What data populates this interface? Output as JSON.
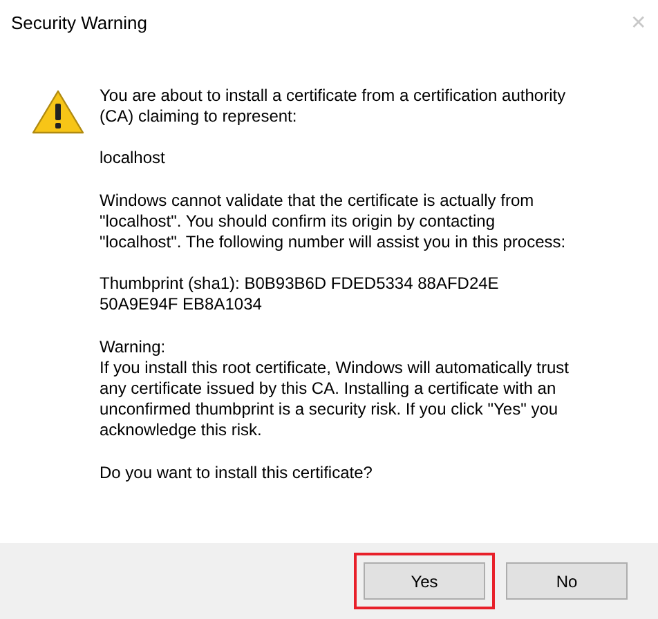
{
  "window": {
    "title": "Security Warning",
    "close": "✕"
  },
  "message": {
    "paragraphs": [
      "You are about to install a certificate from a certification authority (CA) claiming to represent:",
      "localhost",
      "Windows cannot validate that the certificate is actually from \"localhost\". You should confirm its origin by contacting \"localhost\". The following number will assist you in this process:",
      "Thumbprint (sha1): B0B93B6D FDED5334 88AFD24E 50A9E94F EB8A1034",
      "Warning:\nIf you install this root certificate, Windows will automatically trust any certificate issued by this CA. Installing a certificate with an unconfirmed thumbprint is a security risk. If you click \"Yes\" you acknowledge this risk.",
      "Do you want to install this certificate?"
    ]
  },
  "buttons": [
    {
      "label": "Yes",
      "highlighted": true
    },
    {
      "label": "No",
      "highlighted": false
    }
  ]
}
